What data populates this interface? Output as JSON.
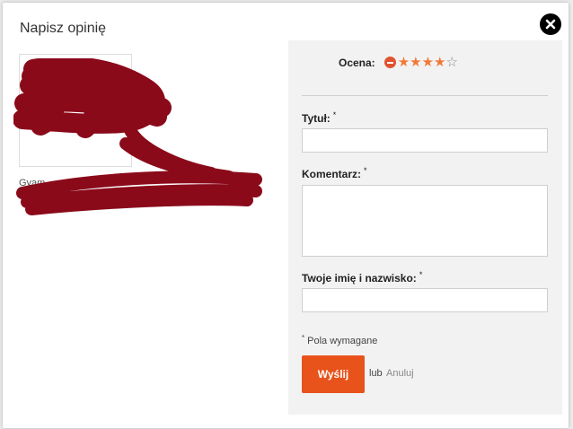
{
  "modal": {
    "title": "Napisz opinię",
    "close_icon": "close-icon"
  },
  "product": {
    "name": "Gyam ... geyati"
  },
  "form": {
    "rating": {
      "label": "Ocena:",
      "value": 4,
      "max": 5,
      "stars": [
        "★",
        "★",
        "★",
        "★",
        "☆"
      ],
      "star_color": "#f07a35",
      "clear_icon": "minus-circle-icon",
      "clear_color": "#e1532f"
    },
    "title_label": "Tytuł:",
    "title_value": "",
    "comment_label": "Komentarz:",
    "comment_value": "",
    "name_label": "Twoje imię i nazwisko:",
    "name_value": "",
    "required_mark": "*",
    "required_note": "Pola wymagane",
    "submit_label": "Wyślij",
    "or_text": "lub",
    "cancel_label": "Anuluj",
    "accent_color": "#e8531c"
  }
}
